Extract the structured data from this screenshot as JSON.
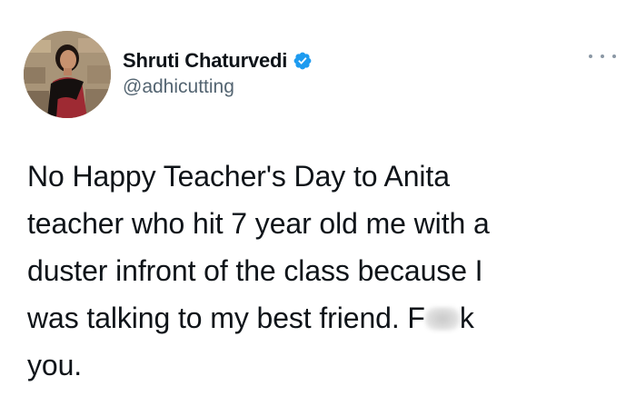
{
  "author": {
    "display_name": "Shruti Chaturvedi",
    "handle": "@adhicutting",
    "verified": true
  },
  "menu": {
    "icon": "more-horizontal-icon"
  },
  "tweet": {
    "lines": [
      "No Happy Teacher's Day to Anita",
      "teacher who hit 7 year old me with a",
      "duster infront of the class because I",
      "was talking to my best friend. F",
      "you."
    ],
    "censored_tail": "k"
  },
  "colors": {
    "text": "#0f1419",
    "secondary": "#536471",
    "verified": "#1d9bf0",
    "background": "#ffffff"
  }
}
